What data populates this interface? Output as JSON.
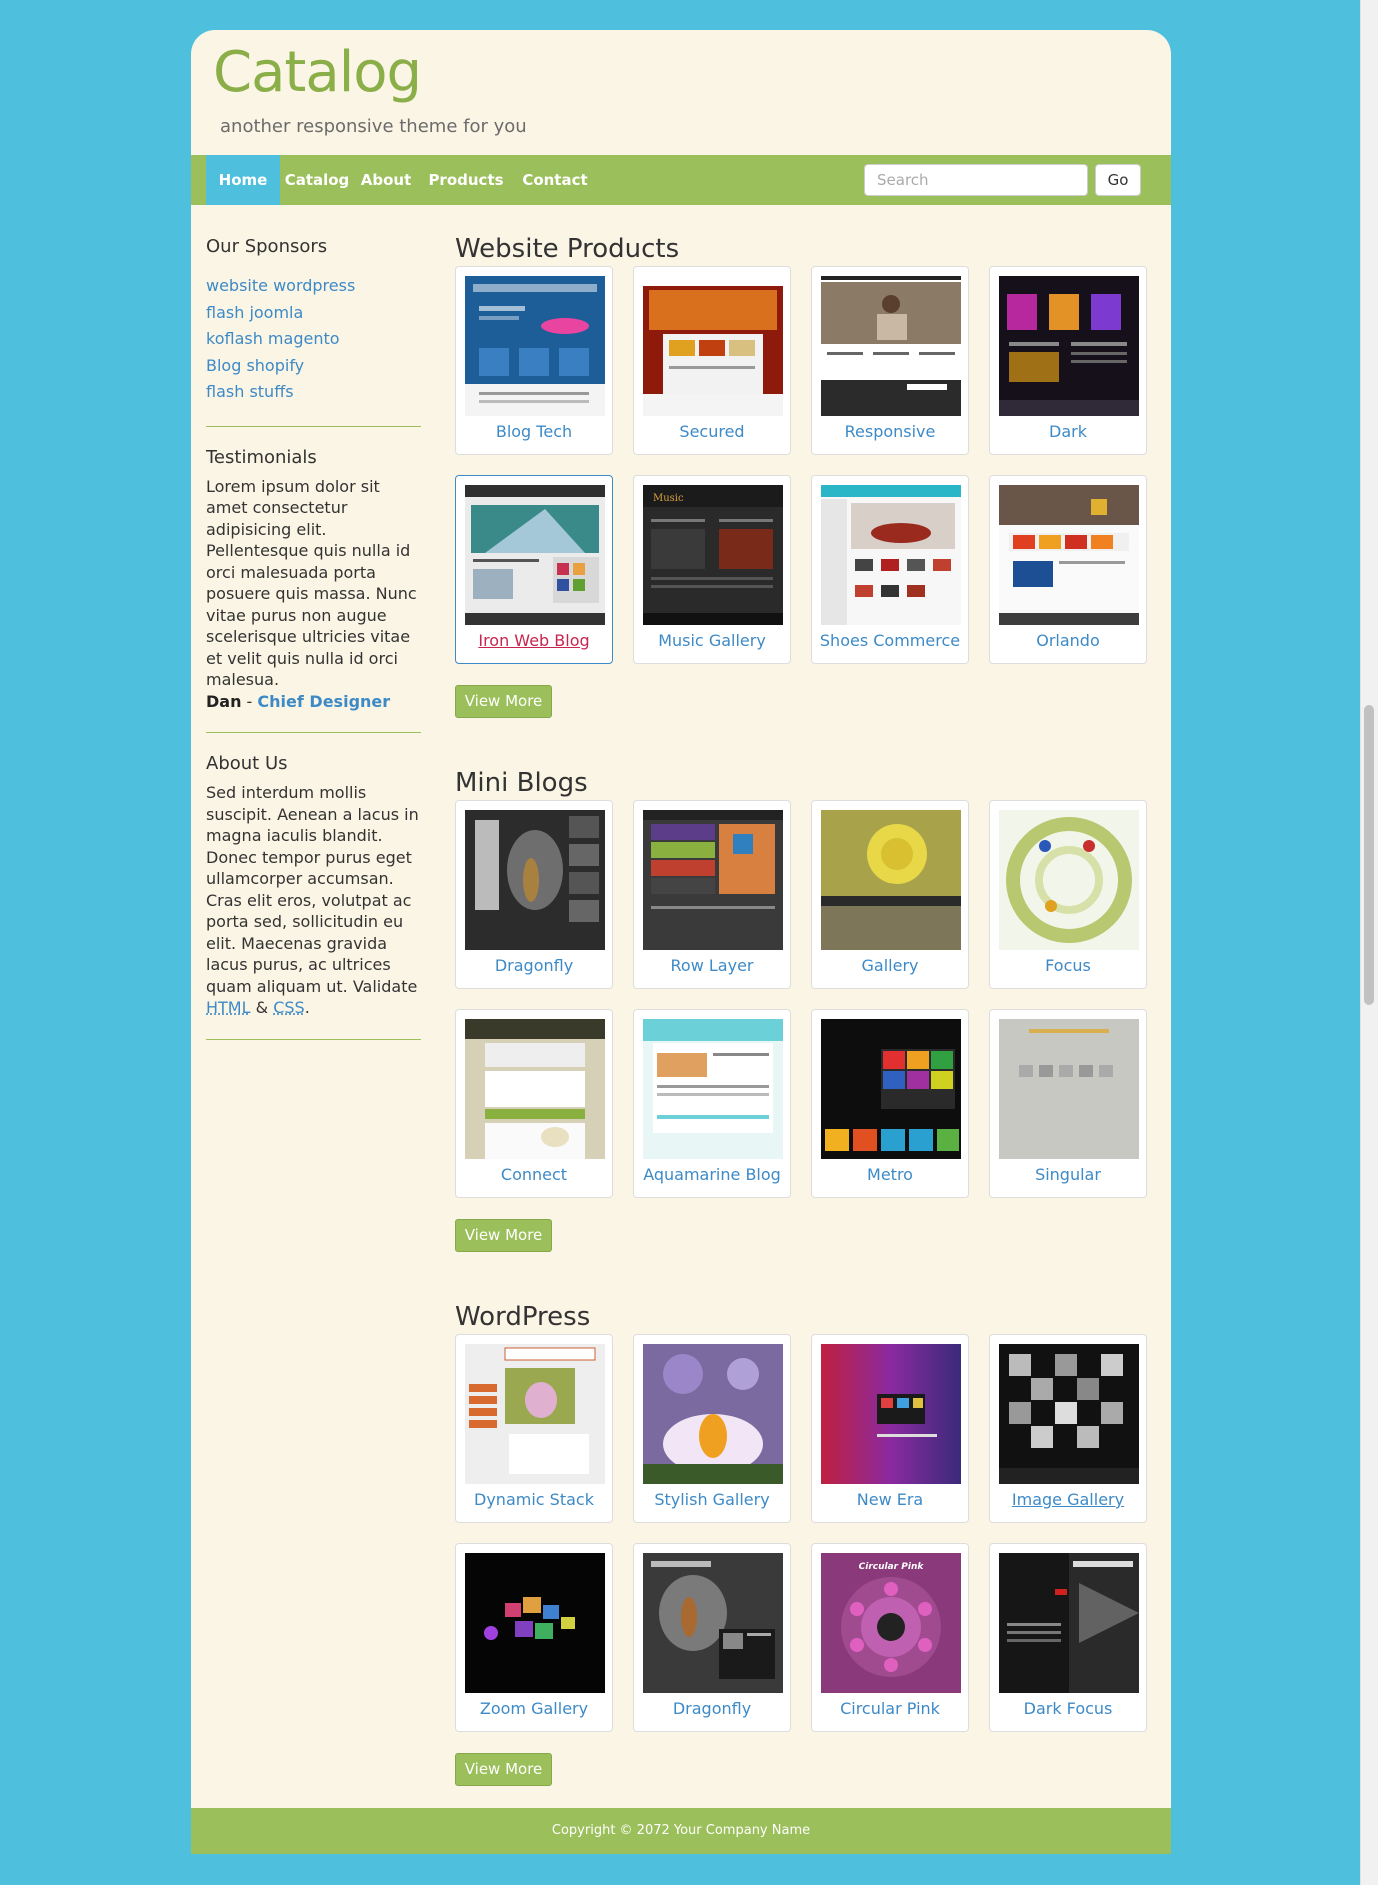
{
  "header": {
    "logo": "Catalog",
    "tagline": "another responsive theme for you"
  },
  "nav": {
    "items": [
      {
        "label": "Home",
        "active": true
      },
      {
        "label": "Catalog",
        "active": false
      },
      {
        "label": "About",
        "active": false
      },
      {
        "label": "Products",
        "active": false
      },
      {
        "label": "Contact",
        "active": false
      }
    ],
    "search_placeholder": "Search",
    "go_label": "Go"
  },
  "sidebar": {
    "sponsors_title": "Our Sponsors",
    "sponsors": [
      "website wordpress",
      "flash joomla",
      "koflash magento",
      "Blog shopify",
      "flash stuffs"
    ],
    "testimonials_title": "Testimonials",
    "testimonial_text": "Lorem ipsum dolor sit amet consectetur adipisicing elit. Pellentesque quis nulla id orci malesuada porta posuere quis massa. Nunc vitae purus non augue scelerisque ultricies vitae et velit quis nulla id orci malesua.",
    "testimonial_author": "Dan",
    "testimonial_separator": " - ",
    "testimonial_role": "Chief Designer",
    "about_title": "About Us",
    "about_text": "Sed interdum mollis suscipit. Aenean a lacus in magna iaculis blandit. Donec tempor purus eget ullamcorper accumsan. Cras elit eros, volutpat ac porta sed, sollicitudin eu elit. Maecenas gravida lacus purus, ac ultrices quam aliquam ut.",
    "validate_prefix": "Validate",
    "validate_html": "HTML",
    "validate_amp": "&",
    "validate_css": "CSS",
    "validate_suffix": "."
  },
  "sections": [
    {
      "title": "Website Products",
      "items": [
        "Blog Tech",
        "Secured",
        "Responsive",
        "Dark",
        "Iron Web Blog",
        "Music Gallery",
        "Shoes Commerce",
        "Orlando"
      ],
      "view_more": "View More"
    },
    {
      "title": "Mini Blogs",
      "items": [
        "Dragonfly",
        "Row Layer",
        "Gallery",
        "Focus",
        "Connect",
        "Aquamarine Blog",
        "Metro",
        "Singular"
      ],
      "view_more": "View More"
    },
    {
      "title": "WordPress",
      "items": [
        "Dynamic Stack",
        "Stylish Gallery",
        "New Era",
        "Image Gallery",
        "Zoom Gallery",
        "Dragonfly",
        "Circular Pink",
        "Dark Focus"
      ],
      "view_more": "View More"
    }
  ],
  "footer": {
    "copyright": "Copyright © 2072 Your Company Name"
  },
  "colors": {
    "background": "#4ec0de",
    "page": "#fbf5e5",
    "accent_green": "#9bbf5a",
    "logo_green": "#8aae48",
    "link_blue": "#3d8ac7"
  }
}
